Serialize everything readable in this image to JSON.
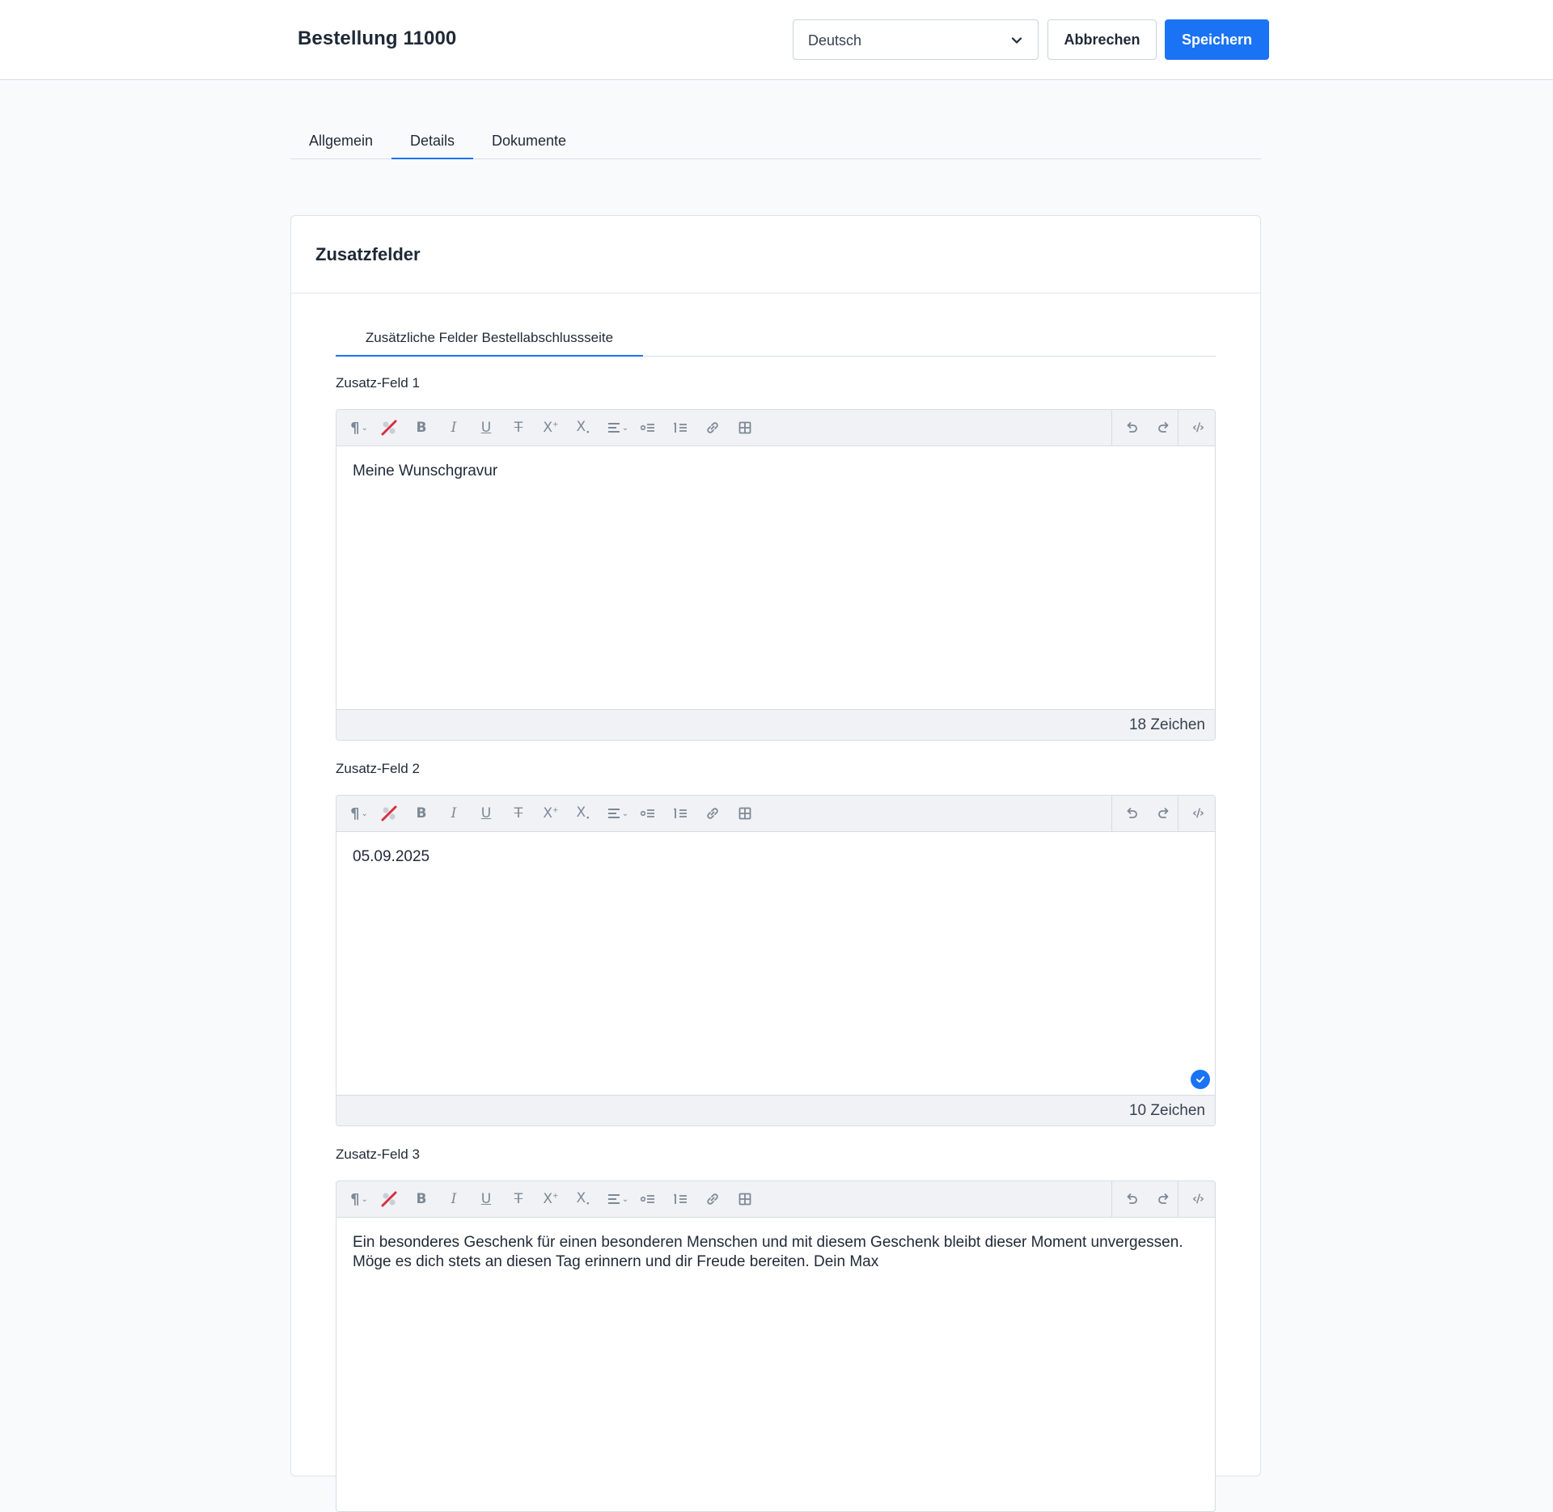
{
  "header": {
    "title": "Bestellung 11000",
    "language_select": {
      "value": "Deutsch"
    },
    "cancel_label": "Abbrechen",
    "save_label": "Speichern"
  },
  "tabs": [
    {
      "label": "Allgemein",
      "active": false
    },
    {
      "label": "Details",
      "active": true
    },
    {
      "label": "Dokumente",
      "active": false
    }
  ],
  "card": {
    "title": "Zusatzfelder",
    "subtab_label": "Zusätzliche Felder Bestellabschlussseite"
  },
  "fields": [
    {
      "label": "Zusatz-Feld 1",
      "content": "Meine Wunschgravur",
      "char_count": "18 Zeichen",
      "valid": false
    },
    {
      "label": "Zusatz-Feld 2",
      "content": "05.09.2025",
      "char_count": "10 Zeichen",
      "valid": true
    },
    {
      "label": "Zusatz-Feld 3",
      "content": "Ein besonderes Geschenk für einen besonderen Menschen und mit diesem Geschenk bleibt dieser Moment unvergessen. Möge es dich stets an diesen Tag erinnern und dir Freude bereiten. Dein Max",
      "char_count": "",
      "valid": false
    }
  ],
  "toolbar_icons": [
    "paragraph-format-icon",
    "remove-format-icon",
    "bold-icon",
    "italic-icon",
    "underline-icon",
    "strikethrough-icon",
    "superscript-icon",
    "subscript-icon",
    "text-align-icon",
    "bullet-list-icon",
    "numbered-list-icon",
    "link-icon",
    "table-icon",
    "undo-icon",
    "redo-icon",
    "code-view-icon"
  ],
  "colors": {
    "primary": "#1a73f4",
    "page_background": "#f9fafc",
    "toolbar_background": "#f0f2f5",
    "icon_gray": "#7d8896",
    "remove_format_red": "#d92d3f"
  }
}
